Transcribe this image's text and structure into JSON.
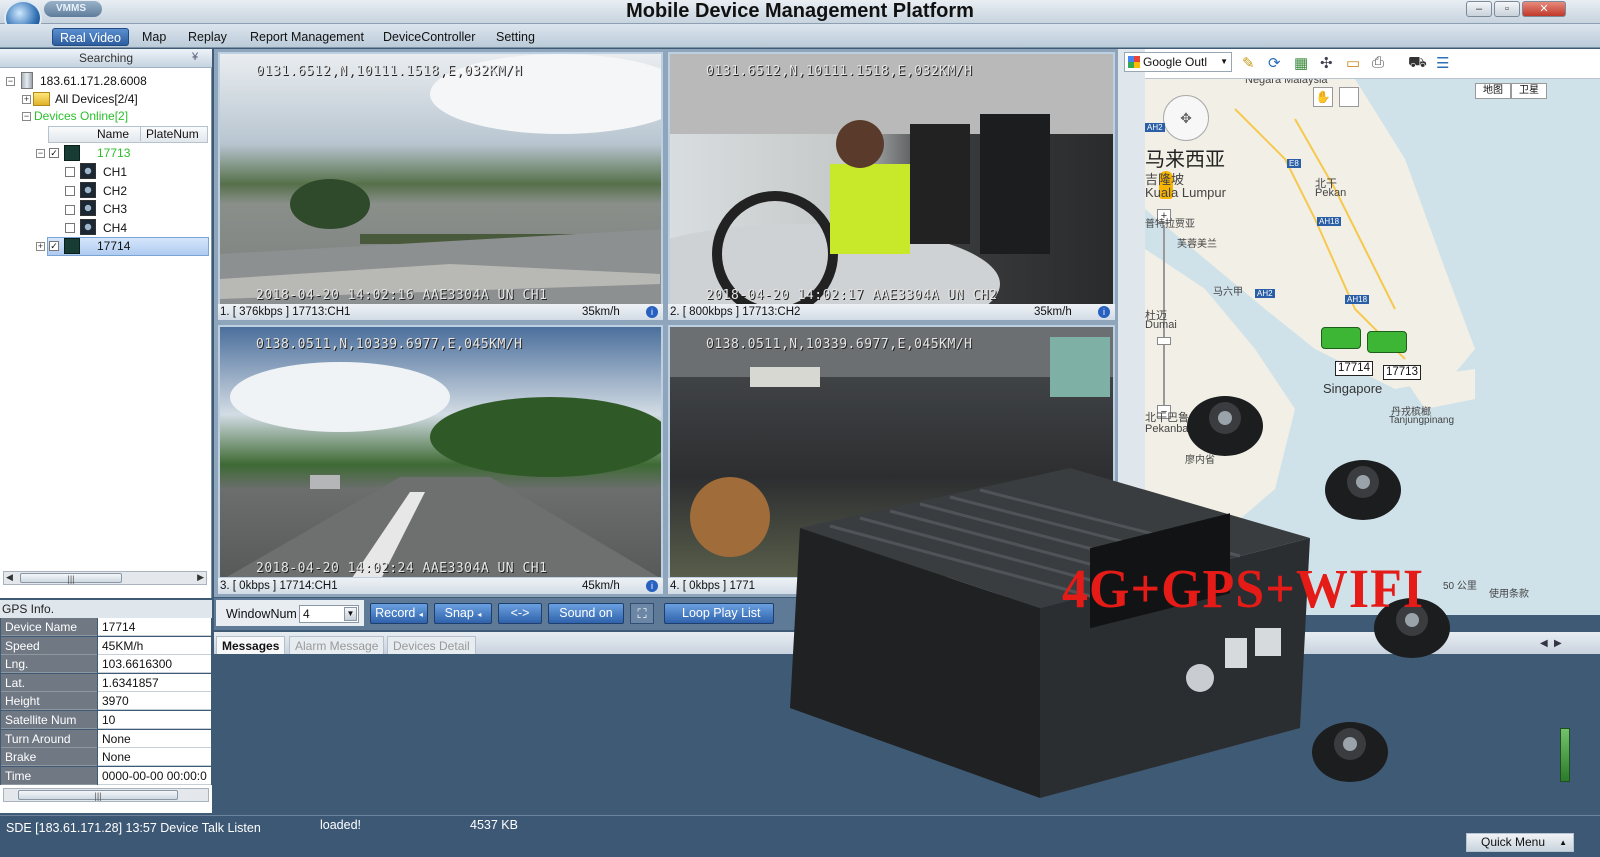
{
  "window": {
    "title": "Mobile Device Management Platform",
    "badge": "VMMS",
    "buttons": [
      "–",
      "▫",
      "✕"
    ]
  },
  "menu": [
    "Real Video",
    "Map",
    "Replay",
    "Report Management",
    "DeviceController",
    "Setting"
  ],
  "search": {
    "label": "Searching",
    "collapse_icon": "double-chevron-down"
  },
  "tree": {
    "server": "183.61.171.28.6008",
    "all_devices": "All Devices[2/4]",
    "online": "Devices Online[2]",
    "columns": [
      "Name",
      "PlateNum"
    ],
    "devices": [
      {
        "name": "17713",
        "checked": true,
        "channels": [
          "CH1",
          "CH2",
          "CH3",
          "CH4"
        ],
        "color": "#2bbf2b"
      },
      {
        "name": "17714",
        "checked": true,
        "selected": true
      }
    ]
  },
  "gps": {
    "title": "GPS Info.",
    "rows": [
      {
        "k": "Device Name",
        "v": "17714"
      },
      {
        "k": "Speed",
        "v": "45KM/h"
      },
      {
        "k": "Lng.",
        "v": "103.6616300"
      },
      {
        "k": "Lat.",
        "v": "1.6341857"
      },
      {
        "k": "Height",
        "v": "3970"
      },
      {
        "k": "Satellite Num",
        "v": "10"
      },
      {
        "k": "Turn Around",
        "v": "None"
      },
      {
        "k": "Brake",
        "v": "None"
      },
      {
        "k": "Time",
        "v": "0000-00-00 00:00:0"
      }
    ]
  },
  "videos": [
    {
      "info": "1. [ 376kbps ] 17713:CH1",
      "speed": "35km/h",
      "osd_top": "0131.6512,N,10111.1518,E,032KM/H",
      "osd_bottom": "2018-04-20  14:02:16  AAE3304A  UN   CH1"
    },
    {
      "info": "2. [ 800kbps ] 17713:CH2",
      "speed": "35km/h",
      "osd_top": "0131.6512,N,10111.1518,E,032KM/H",
      "osd_bottom": "2018-04-20  14:02:17  AAE3304A  UN   CH2"
    },
    {
      "info": "3. [ 0kbps ] 17714:CH1",
      "speed": "45km/h",
      "osd_top": "0138.0511,N,10339.6977,E,045KM/H",
      "osd_bottom": "2018-04-20  14:02:24  AAE3304A  UN   CH1"
    },
    {
      "info": "4. [ 0kbps ] 1771",
      "speed": "",
      "osd_top": "0138.0511,N,10339.6977,E,045KM/H",
      "osd_bottom": ""
    }
  ],
  "toolbar": {
    "window_num_label": "WindowNum",
    "window_num_value": "4",
    "record": "Record",
    "snap": "Snap",
    "swap": "<->",
    "sound": "Sound on",
    "loop": "Loop Play List"
  },
  "messages": {
    "tabs": [
      "Messages",
      "Alarm Message",
      "Devices Detail"
    ]
  },
  "status": {
    "left": "SDE [183.61.171.28] 13:57 Device Talk Listen",
    "loaded": "loaded!",
    "size": "4537 KB",
    "quick_menu": "Quick Menu"
  },
  "map": {
    "provider": "Google Outl",
    "map_types": [
      "地图",
      "卫星"
    ],
    "labels": {
      "malaysia": "Negara Malaysia",
      "kl_top": "Kuala Lumpur",
      "cn_malaysia": "马来西亚",
      "kl_cn": "吉隆坡",
      "kl_en": "Kuala Lumpur",
      "putrajaya": "普特拉贾亚",
      "pekan_cn": "北干",
      "pekan": "Pekan",
      "seremban": "芙蓉美兰",
      "muar": "马六甲",
      "dumai_cn": "杜迈",
      "dumai": "Dumai",
      "singapore": "Singapore",
      "pekanbaru_cn": "北干巴鲁",
      "pekanbaru": "Pekanbaru",
      "tanjung_cn": "丹戎槟榔",
      "tanjung": "Tanjungpinang",
      "riau": "廖内省",
      "scale": "50 公里",
      "terms": "使用条款"
    },
    "roads": [
      "AH2",
      "E8",
      "AH18",
      "AH2",
      "AH18"
    ],
    "vehicles": [
      "17714",
      "17713"
    ]
  },
  "overlay": {
    "promo": "4G+GPS+WIFI"
  },
  "colors": {
    "menu_active": "#2d5e9f",
    "online": "#2bbf2b",
    "promo": "#e51b17",
    "vehicle": "#3db535"
  }
}
